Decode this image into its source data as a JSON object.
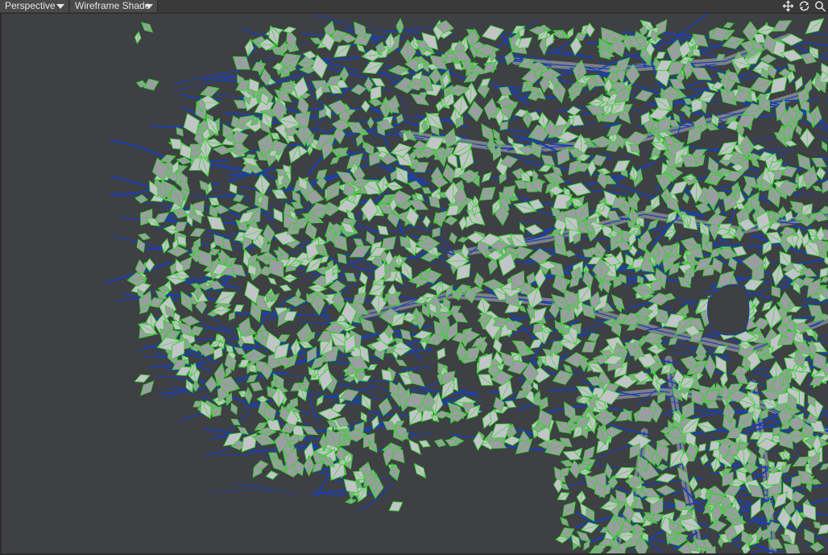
{
  "viewport": {
    "view_mode": "Perspective",
    "shading_mode": "Wireframe Shade"
  },
  "icons": {
    "view_dropdown": "chevron-down-icon",
    "shade_dropdown": "chevron-down-icon",
    "move": "move-arrows-icon",
    "rotate": "rotate-icon",
    "zoom": "magnifier-icon"
  },
  "colors": {
    "background": "#3e4043",
    "header": "#3a3a3a",
    "leaf_fill": "#9a9ea0",
    "leaf_fill_light": "#c2c5c7",
    "leaf_wire": "#35d22f",
    "branch_wire": "#1b3fb0",
    "branch_fill": "#7d8087"
  }
}
